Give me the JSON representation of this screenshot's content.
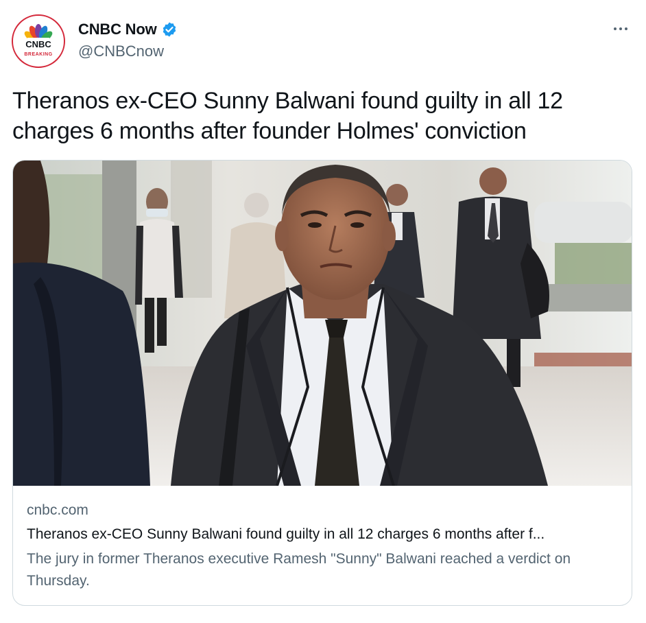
{
  "author": {
    "name": "CNBC Now",
    "handle": "@CNBCnow",
    "verified": true,
    "avatar_logo_text": "CNBC",
    "avatar_sub_text": "BREAKING"
  },
  "tweet": {
    "text": "Theranos ex-CEO Sunny Balwani found guilty in all 12 charges 6 months after founder Holmes' conviction"
  },
  "card": {
    "domain": "cnbc.com",
    "title": "Theranos ex-CEO Sunny Balwani found guilty in all 12 charges 6 months after f...",
    "description": "The jury in former Theranos executive Ramesh \"Sunny\" Balwani reached a verdict on Thursday."
  },
  "colors": {
    "text_primary": "#0f1419",
    "text_secondary": "#536471",
    "verified_blue": "#1d9bf0",
    "card_border": "#cfd9de",
    "brand_red": "#d4283a"
  },
  "icons": {
    "verified": "verified-badge-icon",
    "more": "more-horizontal-icon"
  }
}
